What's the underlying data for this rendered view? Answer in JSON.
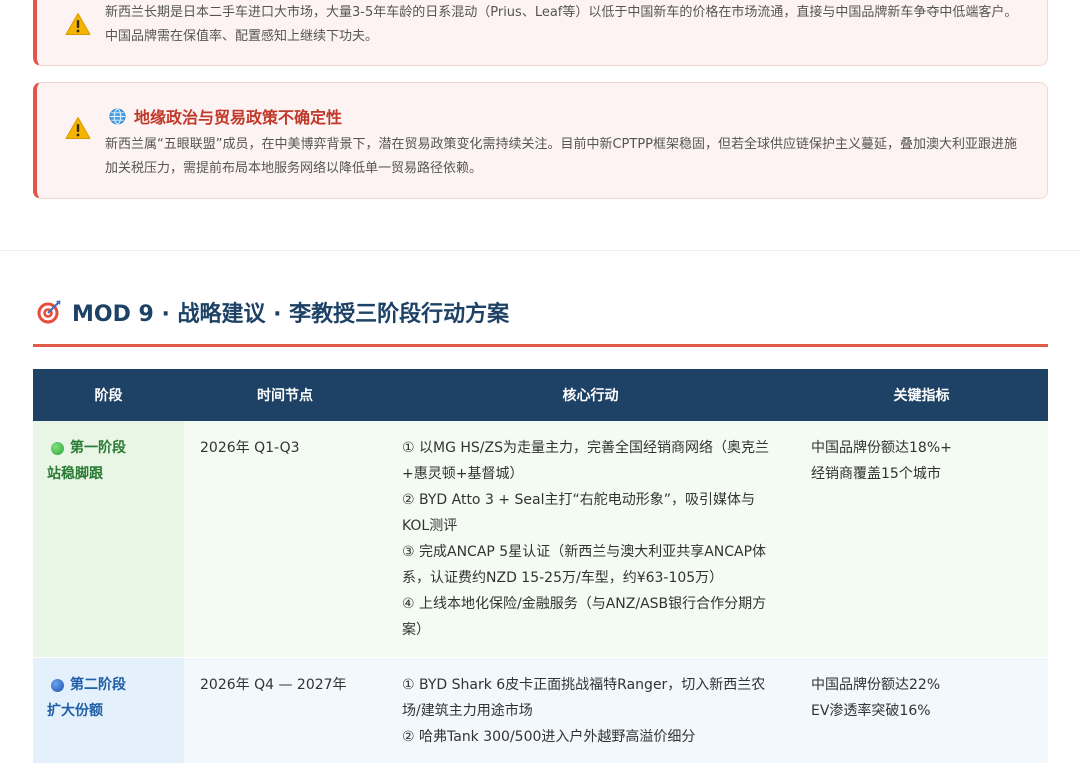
{
  "risk_cards": [
    {
      "title": "",
      "body": "新西兰长期是日本二手车进口大市场，大量3-5年车龄的日系混动（Prius、Leaf等）以低于中国新车的价格在市场流通，直接与中国品牌新车争夺中低端客户。中国品牌需在保值率、配置感知上继续下功夫。"
    },
    {
      "title": "地缘政治与贸易政策不确定性",
      "body": "新西兰属“五眼联盟”成员，在中美博弈背景下，潜在贸易政策变化需持续关注。目前中新CPTPP框架稳固，但若全球供应链保护主义蔓延，叠加澳大利亚跟进施加关税压力，需提前布局本地服务网络以降低单一贸易路径依赖。"
    }
  ],
  "module": {
    "title": "MOD 9 · 战略建议 · 李教授三阶段行动方案"
  },
  "table": {
    "headers": [
      "阶段",
      "时间节点",
      "核心行动",
      "关键指标"
    ],
    "rows": [
      {
        "phase_line1": "第一阶段",
        "phase_line2": "站稳脚跟",
        "timing": "2026年 Q1-Q3",
        "actions": [
          "① 以MG HS/ZS为走量主力，完善全国经销商网络（奥克兰+惠灵顿+基督城）",
          "② BYD Atto 3 + Seal主打“右舵电动形象”，吸引媒体与KOL测评",
          "③ 完成ANCAP 5星认证（新西兰与澳大利亚共享ANCAP体系，认证费约NZD 15-25万/车型，约¥63-105万）",
          "④ 上线本地化保险/金融服务（与ANZ/ASB银行合作分期方案）"
        ],
        "metrics": [
          "中国品牌份额达18%+",
          "经销商覆盖15个城市"
        ]
      },
      {
        "phase_line1": "第二阶段",
        "phase_line2": "扩大份额",
        "timing": "2026年 Q4 — 2027年",
        "actions": [
          "① BYD Shark 6皮卡正面挑战福特Ranger，切入新西兰农场/建筑主力用途市场",
          "② 哈弗Tank 300/500进入户外越野高溢价细分"
        ],
        "metrics": [
          "中国品牌份额达22%",
          "EV渗透率突破16%"
        ]
      }
    ]
  },
  "colors": {
    "navy": "#1e4266",
    "accent_red": "#e05a48",
    "phase1_green": "#2a7a35",
    "phase2_blue": "#1f5fa8"
  },
  "icons": [
    "warning-icon",
    "globe-icon",
    "target-icon",
    "green-dot-icon",
    "blue-dot-icon"
  ]
}
